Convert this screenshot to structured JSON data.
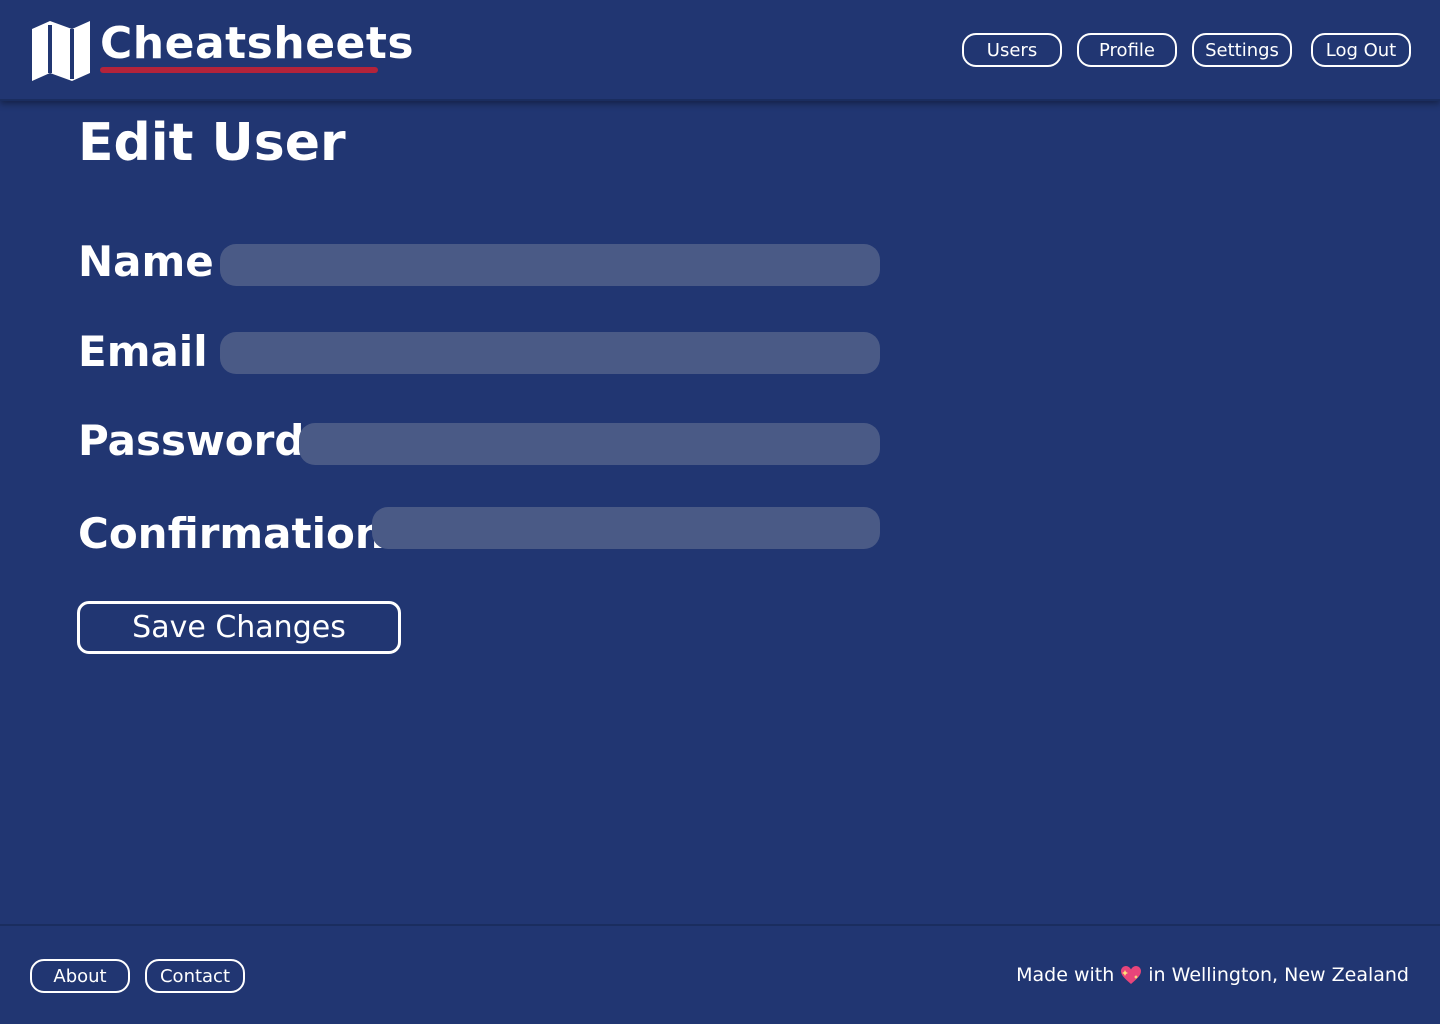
{
  "header": {
    "brand": "Cheatsheets",
    "nav": {
      "users": "Users",
      "profile": "Profile",
      "settings": "Settings",
      "logout": "Log Out"
    }
  },
  "main": {
    "title": "Edit User",
    "fields": {
      "name": {
        "label": "Name",
        "value": "",
        "placeholder": ""
      },
      "email": {
        "label": "Email",
        "value": "",
        "placeholder": ""
      },
      "password": {
        "label": "Password",
        "value": "",
        "placeholder": ""
      },
      "confirmation": {
        "label": "Confirmation",
        "value": "",
        "placeholder": ""
      }
    },
    "save_label": "Save Changes"
  },
  "footer": {
    "about": "About",
    "contact": "Contact",
    "credit_before": "Made with",
    "credit_after": "in Wellington, New Zealand",
    "heart_icon": "sparkling-heart-icon"
  },
  "colors": {
    "background": "#213672",
    "brand_underline": "#b3233a",
    "input_fill": "#4a5a86",
    "text": "#ffffff"
  }
}
